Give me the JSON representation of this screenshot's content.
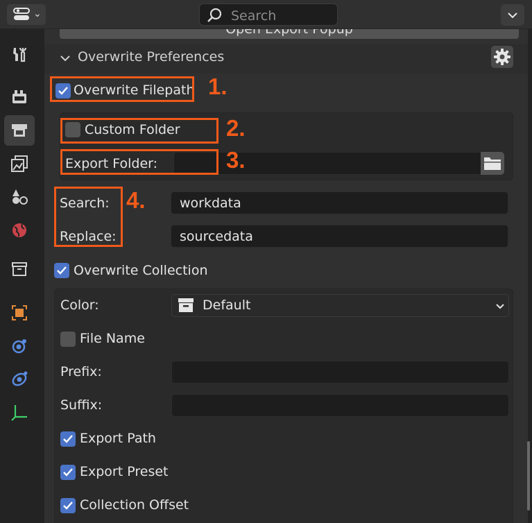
{
  "header": {
    "search_placeholder": "Search"
  },
  "panel": {
    "popup_button_label": "Open Export Popup",
    "section_title": "Overwrite Preferences",
    "overwrite_filepath": {
      "label": "Overwrite Filepath",
      "checked": true
    },
    "custom_folder": {
      "label": "Custom Folder",
      "checked": false
    },
    "export_folder": {
      "label": "Export Folder:",
      "value": ""
    },
    "search": {
      "label": "Search:",
      "value": "workdata"
    },
    "replace": {
      "label": "Replace:",
      "value": "sourcedata"
    },
    "overwrite_collection": {
      "label": "Overwrite Collection",
      "checked": true
    },
    "color": {
      "label": "Color:",
      "value": "Default"
    },
    "file_name": {
      "label": "File Name",
      "checked": false
    },
    "prefix": {
      "label": "Prefix:",
      "value": ""
    },
    "suffix": {
      "label": "Suffix:",
      "value": ""
    },
    "export_path": {
      "label": "Export Path",
      "checked": true
    },
    "export_preset": {
      "label": "Export Preset",
      "checked": true
    },
    "collection_offset": {
      "label": "Collection Offset",
      "checked": true
    }
  },
  "annotations": [
    "1.",
    "2.",
    "3.",
    "4."
  ],
  "side_tabs": [
    "tool-icon",
    "render-icon",
    "output-icon",
    "view-layer-icon",
    "scene-icon",
    "world-icon",
    "collection-icon",
    "object-icon",
    "modifier-icon",
    "physics-icon",
    "constraints-icon"
  ],
  "colors": {
    "accent": "#4b74c8",
    "annotation": "#f05a1a"
  }
}
